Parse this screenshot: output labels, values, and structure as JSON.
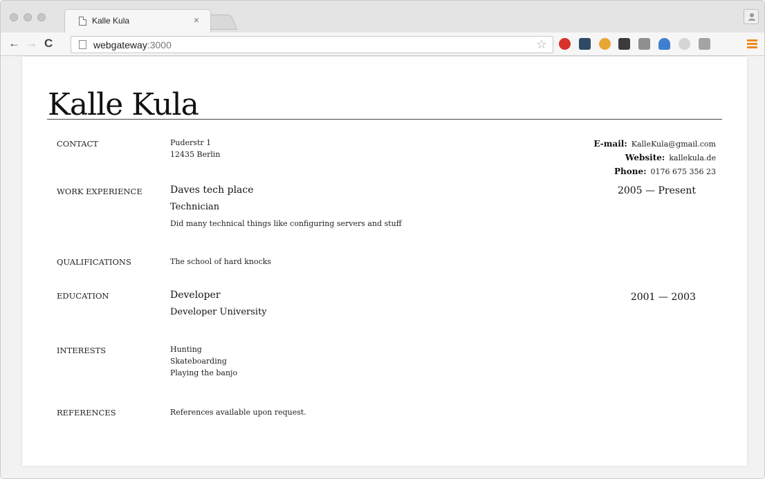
{
  "browser": {
    "tab_title": "Kalle Kula",
    "tab_close": "×",
    "url_host": "webgateway",
    "url_port": ":3000",
    "nav": {
      "back": "←",
      "forward": "→",
      "reload": "C"
    },
    "star": "☆"
  },
  "resume": {
    "name": "Kalle Kula",
    "contact": {
      "label": "CONTACT",
      "address_line1": "Puderstr 1",
      "address_line2": "12435 Berlin",
      "email_label": "E-mail:",
      "email": "KalleKula@gmail.com",
      "website_label": "Website:",
      "website": "kallekula.de",
      "phone_label": "Phone:",
      "phone": "0176 675 356 23"
    },
    "work": {
      "label": "WORK EXPERIENCE",
      "company": "Daves tech place",
      "role": "Technician",
      "description": "Did many technical things like configuring servers and stuff",
      "dates": "2005 — Present"
    },
    "qualifications": {
      "label": "QUALIFICATIONS",
      "text": "The school of hard knocks"
    },
    "education": {
      "label": "EDUCATION",
      "degree": "Developer",
      "school": "Developer University",
      "dates": "2001 — 2003"
    },
    "interests": {
      "label": "INTERESTS",
      "items": [
        "Hunting",
        "Skateboarding",
        "Playing the banjo"
      ]
    },
    "references": {
      "label": "REFERENCES",
      "text": "References available upon request."
    }
  },
  "colors": {
    "menu_accent": "#f08a1c",
    "adblock_red": "#d8312a"
  }
}
